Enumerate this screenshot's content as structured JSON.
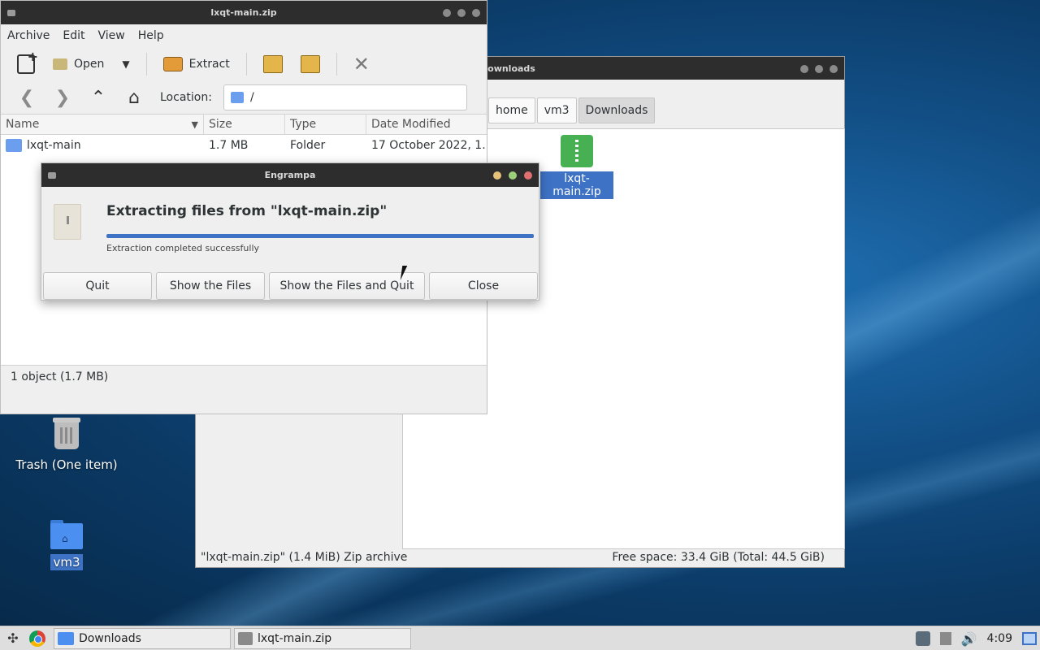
{
  "desktop": {
    "icons": [
      {
        "label": "Trash (One item)"
      },
      {
        "label": "vm3"
      }
    ]
  },
  "file_manager": {
    "title": "Downloads",
    "breadcrumbs": [
      "home",
      "vm3",
      "Downloads"
    ],
    "selected_file": "lxqt-main.zip",
    "status_left": "\"lxqt-main.zip\" (1.4 MiB) Zip archive",
    "status_right": "Free space: 33.4 GiB (Total: 44.5 GiB)"
  },
  "engrampa": {
    "title": "lxqt-main.zip",
    "menu": [
      "Archive",
      "Edit",
      "View",
      "Help"
    ],
    "toolbar": {
      "open_label": "Open",
      "extract_label": "Extract"
    },
    "location_label": "Location:",
    "location_value": "/",
    "columns": [
      "Name",
      "Size",
      "Type",
      "Date Modified"
    ],
    "rows": [
      {
        "name": "lxqt-main",
        "size": "1.7 MB",
        "type": "Folder",
        "modified": "17 October 2022, 1…"
      }
    ],
    "status": "1 object (1.7 MB)"
  },
  "dialog": {
    "title": "Engrampa",
    "heading": "Extracting files from \"lxqt-main.zip\"",
    "message": "Extraction completed successfully",
    "progress": 1.0,
    "buttons": {
      "quit": "Quit",
      "show_files": "Show the Files",
      "show_files_quit": "Show the Files and Quit",
      "close": "Close"
    }
  },
  "taskbar": {
    "tasks": [
      "Downloads",
      "lxqt-main.zip"
    ],
    "clock": "4:09"
  },
  "colors": {
    "accent": "#3d72c4",
    "titlebar": "#2d2d2d",
    "zip_icon": "#46b053"
  }
}
